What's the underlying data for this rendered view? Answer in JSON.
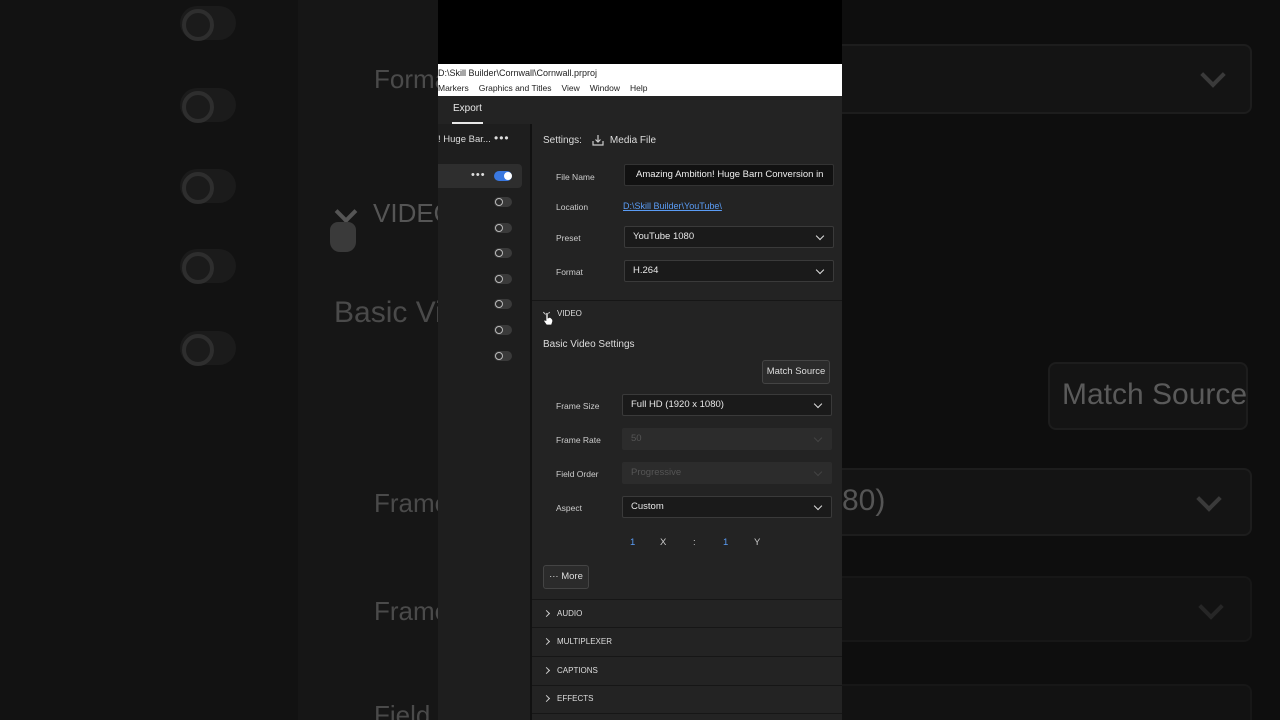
{
  "window": {
    "path": "D:\\Skill Builder\\Cornwall\\Cornwall.prproj"
  },
  "menu": [
    "Markers",
    "Graphics and Titles",
    "View",
    "Window",
    "Help"
  ],
  "tabs": {
    "export": "Export"
  },
  "queue": {
    "title": "! Huge Bar...",
    "more": "•••",
    "item_more": "•••",
    "toggles": [
      true,
      false,
      false,
      false,
      false,
      false,
      false,
      false
    ]
  },
  "settings": {
    "label": "Settings:",
    "target": "Media File",
    "file_name_label": "File Name",
    "file_name_value": "Amazing Ambition! Huge Barn Conversion in",
    "location_label": "Location",
    "location_value": "D:\\Skill Builder\\YouTube\\",
    "preset_label": "Preset",
    "preset_value": "YouTube 1080",
    "format_label": "Format",
    "format_value": "H.264"
  },
  "video": {
    "section_label": "VIDEO",
    "basic_label": "Basic Video Settings",
    "match_source": "Match Source",
    "frame_size_label": "Frame Size",
    "frame_size_value": "Full HD (1920 x 1080)",
    "frame_rate_label": "Frame Rate",
    "frame_rate_value": "50",
    "field_order_label": "Field Order",
    "field_order_value": "Progressive",
    "aspect_label": "Aspect",
    "aspect_value": "Custom",
    "aspect_x_value": "1",
    "aspect_x_label": "X",
    "aspect_sep": ":",
    "aspect_y_value": "1",
    "aspect_y_label": "Y",
    "more_button": "··· More"
  },
  "sections": [
    "AUDIO",
    "MULTIPLEXER",
    "CAPTIONS",
    "EFFECTS"
  ],
  "background": {
    "format_text": "Format",
    "video_text": "VIDEO",
    "basic_text": "Basic Vid",
    "frame1_text": "Frame",
    "frame2_text": "Frame",
    "field_text": "Field O",
    "match_source_text": "Match Source",
    "frame_size_tail": "80)"
  },
  "colors": {
    "accent_blue": "#3a78e0",
    "link_blue": "#5a9cf5",
    "panel_bg": "#232323"
  }
}
